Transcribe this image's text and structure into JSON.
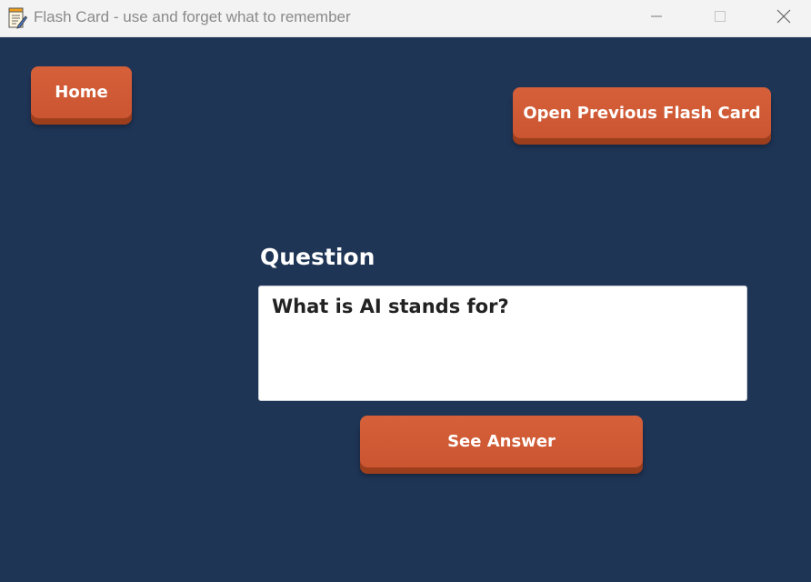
{
  "window": {
    "title": "Flash Card - use and forget what to remember",
    "icon": "notepad-icon",
    "controls": {
      "minimize": "minimize-icon",
      "maximize": "maximize-icon",
      "close": "close-icon"
    }
  },
  "nav": {
    "home_label": "Home",
    "open_previous_label": "Open Previous Flash Card"
  },
  "card": {
    "question_heading": "Question",
    "question_text": "What is AI stands for?",
    "see_answer_label": "See Answer"
  },
  "colors": {
    "background": "#1f3556",
    "button": "#d15b35",
    "button_shadow": "#9c3d1c",
    "titlebar": "#f3f3f3"
  }
}
